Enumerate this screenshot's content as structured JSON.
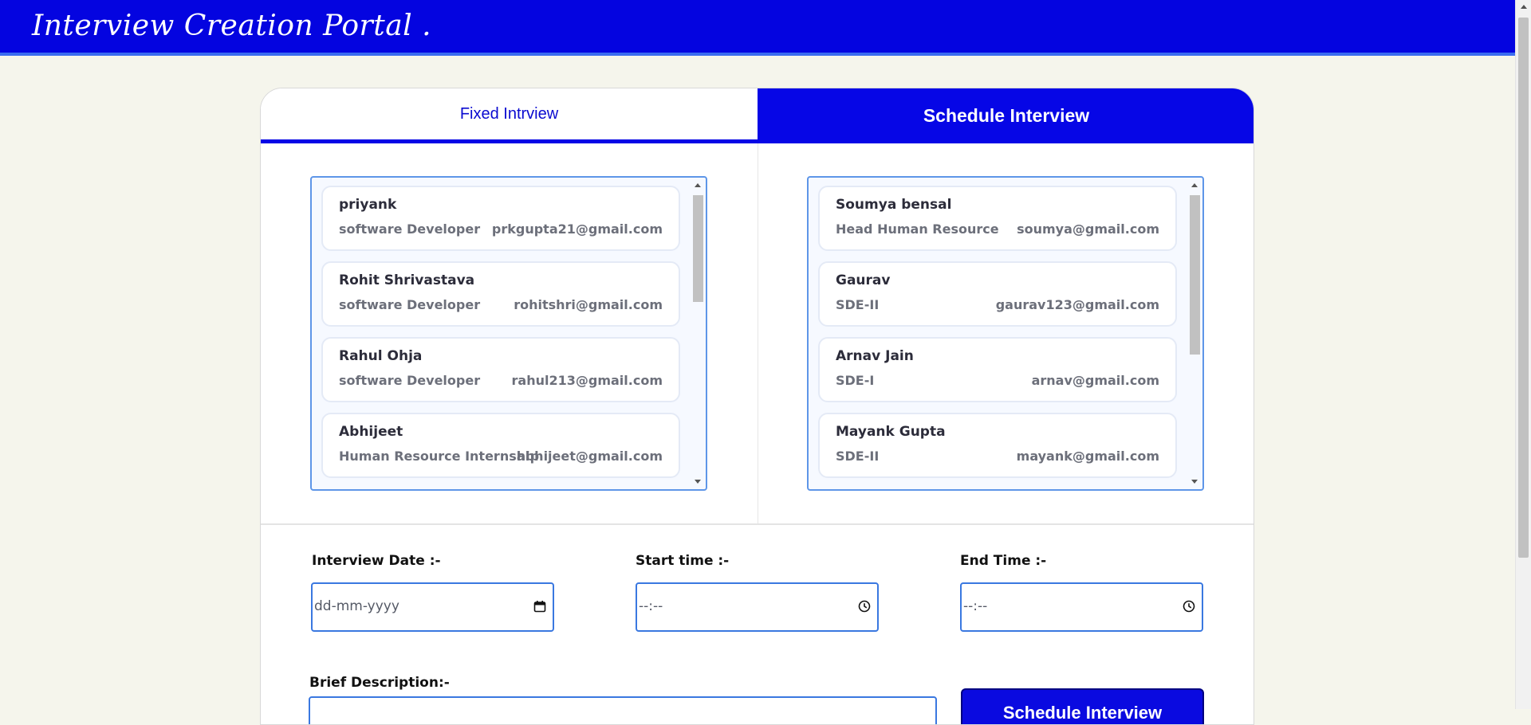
{
  "app": {
    "title": "Interview Creation Portal ."
  },
  "tabs": {
    "fixed": "Fixed Intrview",
    "schedule": "Schedule Interview"
  },
  "left_list": [
    {
      "name": "priyank",
      "role": "software Developer",
      "email": "prkgupta21@gmail.com"
    },
    {
      "name": "Rohit Shrivastava",
      "role": "software Developer",
      "email": "rohitshri@gmail.com"
    },
    {
      "name": "Rahul Ohja",
      "role": "software Developer",
      "email": "rahul213@gmail.com"
    },
    {
      "name": "Abhijeet",
      "role": "Human Resource Internship",
      "email": "abhijeet@gmail.com"
    }
  ],
  "right_list": [
    {
      "name": "Soumya bensal",
      "role": "Head Human Resource",
      "email": "soumya@gmail.com"
    },
    {
      "name": "Gaurav",
      "role": "SDE-II",
      "email": "gaurav123@gmail.com"
    },
    {
      "name": "Arnav Jain",
      "role": "SDE-I",
      "email": "arnav@gmail.com"
    },
    {
      "name": "Mayank Gupta",
      "role": "SDE-II",
      "email": "mayank@gmail.com"
    }
  ],
  "form": {
    "date_label": "Interview Date :-",
    "date_placeholder": "dd-mm-yyyy",
    "start_label": "Start time :-",
    "start_placeholder": "--:--",
    "end_label": "End Time :-",
    "end_placeholder": "--:--",
    "desc_label": "Brief Description:-",
    "submit_label": "Schedule Interview"
  },
  "colors": {
    "primary": "#0606e6",
    "accent_border": "#3a78e0",
    "background": "#f5f5ec"
  },
  "icons": [
    "calendar-icon",
    "clock-icon"
  ]
}
